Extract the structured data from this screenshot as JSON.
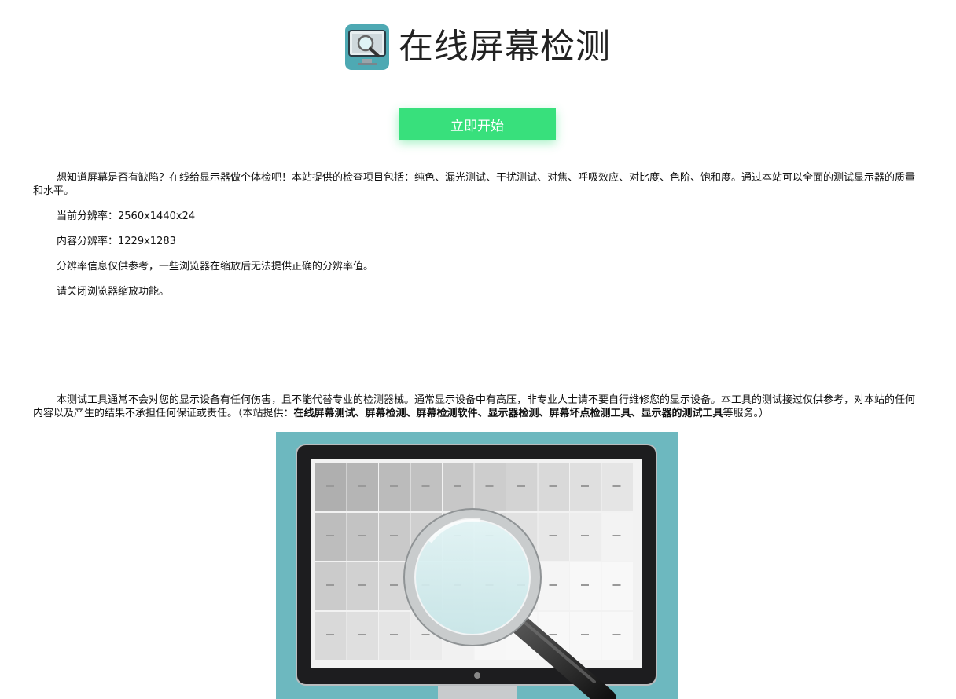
{
  "header": {
    "title": "在线屏幕检测",
    "logo_icon": "monitor-magnifier-icon"
  },
  "start_button": {
    "label": "立即开始",
    "color": "#38e07c"
  },
  "content": {
    "intro": "想知道屏幕是否有缺陷？在线给显示器做个体检吧！本站提供的检查项目包括：纯色、漏光测试、干扰测试、对焦、呼吸效应、对比度、色阶、饱和度。通过本站可以全面的测试显示器的质量和水平。",
    "current_resolution": "当前分辨率：2560x1440x24",
    "content_resolution": "内容分辨率：1229x1283",
    "resolution_note": "分辨率信息仅供参考，一些浏览器在缩放后无法提供正确的分辨率值。",
    "zoom_note": "请关闭浏览器缩放功能。"
  },
  "disclaimer": {
    "text": "本测试工具通常不会对您的显示设备有任何伤害，且不能代替专业的检测器械。通常显示设备中有高压，非专业人士请不要自行维修您的显示设备。本工具的测试接过仅供参考，对本站的任何内容以及产生的结果不承担任何保证或责任。（本站提供：",
    "bold_services": "在线屏幕测试、屏幕检测、屏幕检测软件、显示器检测、屏幕坏点检测工具、显示器的测试工具",
    "suffix": "等服务。）"
  },
  "hero": {
    "icon": "monitor-magnifier-illustration",
    "background_color": "#6db8bf"
  }
}
